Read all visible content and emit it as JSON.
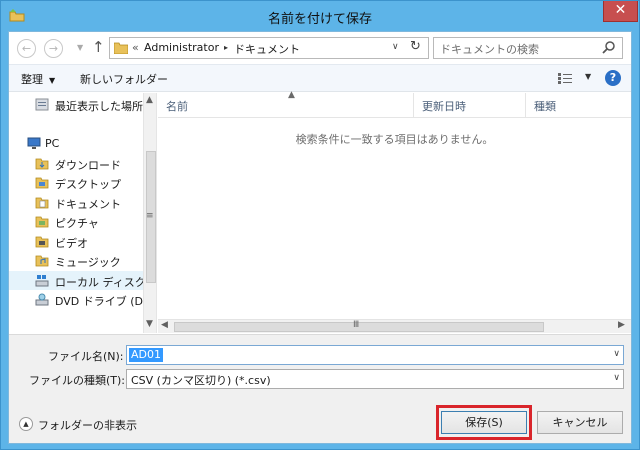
{
  "window": {
    "title": "名前を付けて保存",
    "close_label": "✕"
  },
  "address_bar": {
    "overflow": "«",
    "crumbs": [
      "Administrator",
      "ドキュメント"
    ],
    "separator": "▸"
  },
  "search": {
    "placeholder": "ドキュメントの検索"
  },
  "toolbar": {
    "organize_label": "整理",
    "organize_caret": "▼",
    "new_folder_label": "新しいフォルダー",
    "view_caret": "▼",
    "help_label": "?"
  },
  "nav_pane": {
    "items": [
      {
        "label": "最近表示した場所",
        "icon": "recent-places-icon"
      },
      {
        "label": "PC",
        "icon": "pc-icon"
      },
      {
        "label": "ダウンロード",
        "icon": "downloads-folder-icon"
      },
      {
        "label": "デスクトップ",
        "icon": "desktop-folder-icon"
      },
      {
        "label": "ドキュメント",
        "icon": "documents-folder-icon"
      },
      {
        "label": "ピクチャ",
        "icon": "pictures-folder-icon"
      },
      {
        "label": "ビデオ",
        "icon": "videos-folder-icon"
      },
      {
        "label": "ミュージック",
        "icon": "music-folder-icon"
      },
      {
        "label": "ローカル ディスク (C",
        "icon": "local-disk-icon"
      },
      {
        "label": "DVD ドライブ (D:)",
        "icon": "dvd-drive-icon"
      }
    ],
    "selected_index": 8
  },
  "file_list": {
    "columns": [
      "名前",
      "更新日時",
      "種類"
    ],
    "empty_message": "検索条件に一致する項目はありません。"
  },
  "form": {
    "filename_label": "ファイル名(N):",
    "filename_value": "AD01",
    "filetype_label": "ファイルの種類(T):",
    "filetype_value": "CSV (カンマ区切り) (*.csv)"
  },
  "footer": {
    "hide_folders_label": "フォルダーの非表示",
    "save_label": "保存(S)",
    "cancel_label": "キャンセル"
  },
  "colors": {
    "title_bar": "#5db4e8",
    "close_button": "#c74f4f",
    "highlight_border": "#d9252b",
    "selection": "#3399ff"
  }
}
